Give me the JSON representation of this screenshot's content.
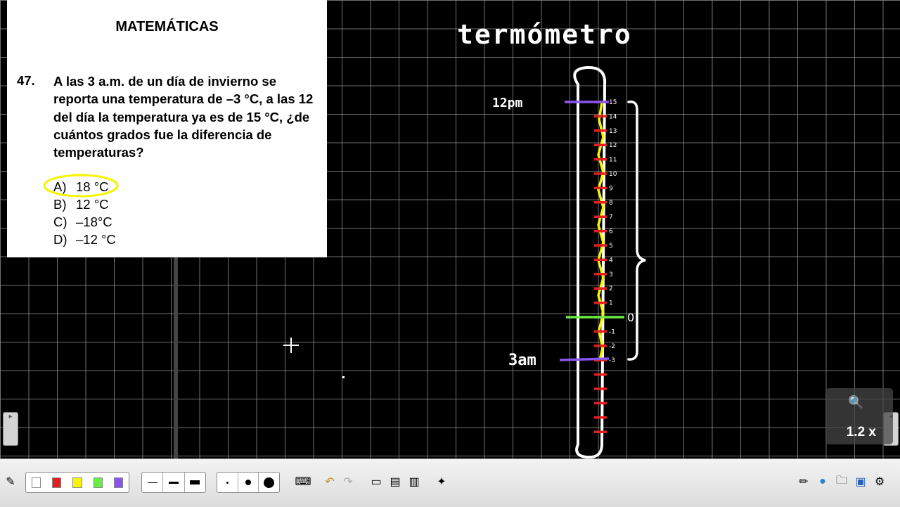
{
  "question": {
    "subject": "MATEMÁTICAS",
    "number": "47.",
    "text": "A las 3 a.m. de un día de invierno se reporta una temperatura de –3 °C, a las 12 del día la temperatura ya es de 15 °C, ¿de cuántos grados fue la diferencia de temperaturas?",
    "options": [
      {
        "letter": "A)",
        "value": "18 °C",
        "circled": true
      },
      {
        "letter": "B)",
        "value": "12 °C"
      },
      {
        "letter": "C)",
        "value": "–18°C"
      },
      {
        "letter": "D)",
        "value": "–12 °C"
      }
    ]
  },
  "handwriting": {
    "title": "termómetro",
    "label_top": "12pm",
    "label_bottom": "3am",
    "zero_mark": "0",
    "scale_labels": [
      "15",
      "14",
      "13",
      "12",
      "11",
      "10",
      "9",
      "8",
      "7",
      "6",
      "5",
      "4",
      "3",
      "2",
      "1",
      "-1",
      "-2",
      "-3"
    ]
  },
  "zoom": {
    "label": "1.2 x"
  },
  "toolbar": {
    "pen_colors": [
      "#ffffff",
      "#e21f1f",
      "#f5f500",
      "#66ee44",
      "#8a55ee"
    ],
    "line_widths": [
      "thin",
      "medium",
      "thick"
    ],
    "dot_sizes": [
      "small",
      "medium",
      "large"
    ]
  }
}
